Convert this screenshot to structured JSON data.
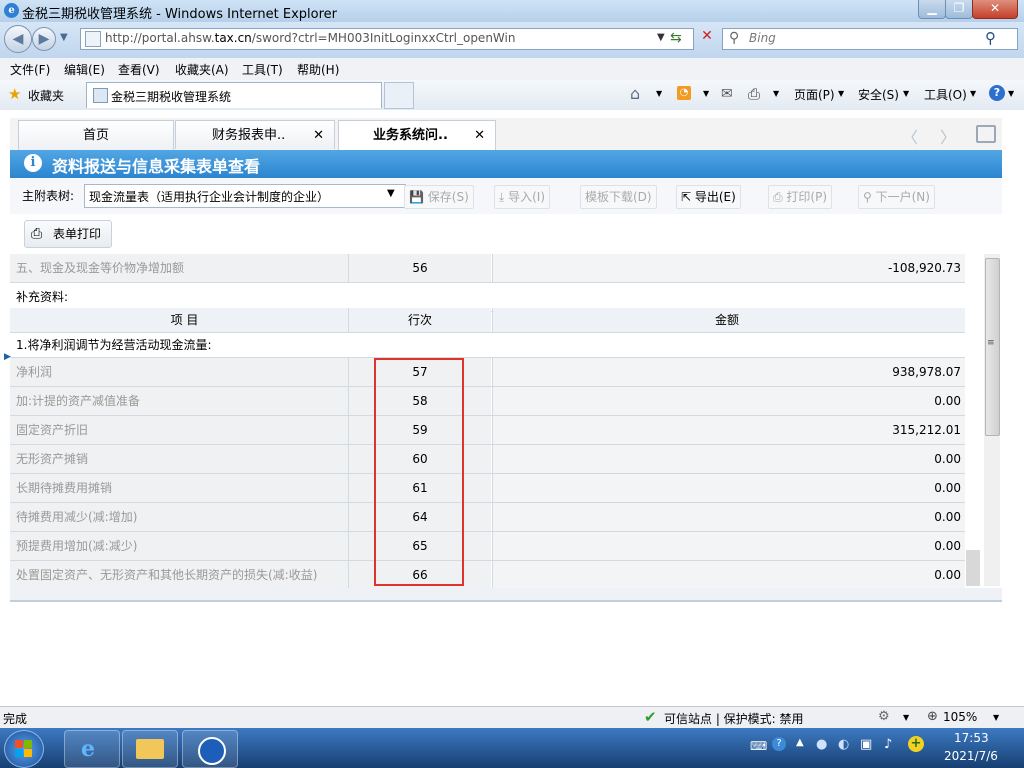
{
  "window": {
    "title": "金税三期税收管理系统 - Windows Internet Explorer",
    "url_prefix": "http://portal.ahsw.",
    "url_domain": "tax.cn",
    "url_suffix": "/sword?ctrl=MH003InitLoginxxCtrl_openWin",
    "search_placeholder": "Bing"
  },
  "menu": [
    "文件(F)",
    "编辑(E)",
    "查看(V)",
    "收藏夹(A)",
    "工具(T)",
    "帮助(H)"
  ],
  "favbar": {
    "favorites_label": "收藏夹",
    "tab_title": "金税三期税收管理系统",
    "page_label": "页面(P)",
    "safety_label": "安全(S)",
    "tools_label": "工具(O)"
  },
  "app_tabs": [
    {
      "label": "首页",
      "closable": false,
      "active": false
    },
    {
      "label": "财务报表申..",
      "closable": true,
      "active": false
    },
    {
      "label": "业务系统问..",
      "closable": true,
      "active": true
    }
  ],
  "panel_title": "资料报送与信息采集表单查看",
  "toolbar": {
    "main_table_label": "主附表树:",
    "selected_table": "现金流量表（适用执行企业会计制度的企业）",
    "save": "保存(S)",
    "import": "导入(I)",
    "template_download": "模板下载(D)",
    "export": "导出(E)",
    "print": "打印(P)",
    "next_user": "下一户(N)",
    "form_print": "表单打印"
  },
  "grid": {
    "top_row": {
      "item": "五、现金及现金等价物净增加额",
      "line": "56",
      "amount": "-108,920.73"
    },
    "supplement_label": "补充资料:",
    "headers": {
      "item": "项 目",
      "line": "行次",
      "amount": "金额"
    },
    "section_label": "1.将净利润调节为经营活动现金流量:",
    "rows": [
      {
        "item": "净利润",
        "line": "57",
        "amount": "938,978.07"
      },
      {
        "item": "加:计提的资产减值准备",
        "line": "58",
        "amount": "0.00"
      },
      {
        "item": "固定资产折旧",
        "line": "59",
        "amount": "315,212.01"
      },
      {
        "item": "无形资产摊销",
        "line": "60",
        "amount": "0.00"
      },
      {
        "item": "长期待摊费用摊销",
        "line": "61",
        "amount": "0.00"
      },
      {
        "item": "待摊费用减少(减:增加)",
        "line": "64",
        "amount": "0.00"
      },
      {
        "item": "预提费用增加(减:减少)",
        "line": "65",
        "amount": "0.00"
      },
      {
        "item": "处置固定资产、无形资产和其他长期资产的损失(减:收益)",
        "line": "66",
        "amount": "0.00"
      }
    ]
  },
  "status": {
    "left": "完成",
    "trusted": "可信站点 | 保护模式: 禁用",
    "zoom": "105%"
  },
  "taskbar": {
    "time": "17:53",
    "date": "2021/7/6"
  },
  "colors": {
    "accent_blue": "#2b85cf",
    "highlight_red": "#e0332d"
  }
}
